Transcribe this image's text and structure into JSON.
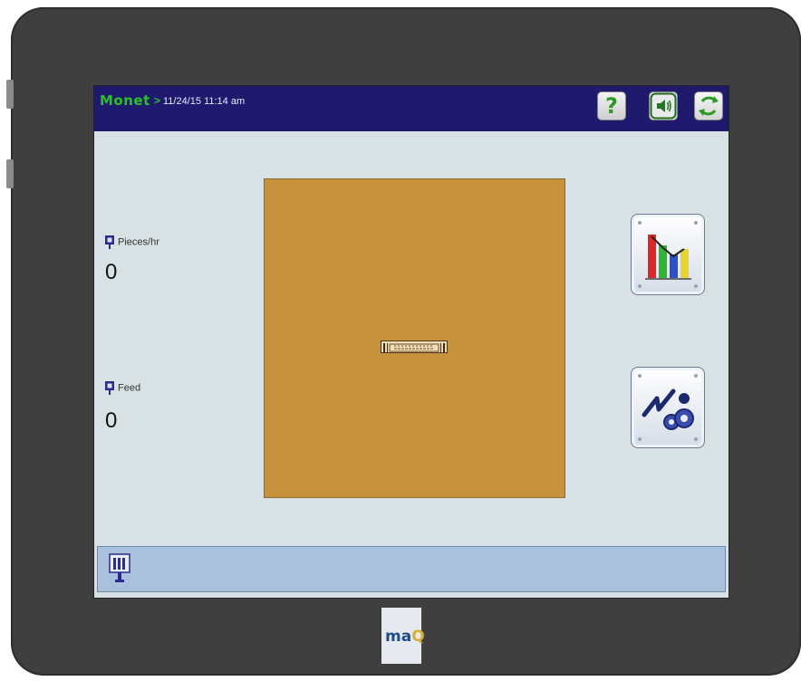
{
  "header": {
    "brand": "Monet",
    "separator": ">",
    "date": "11/24/15",
    "time": "11:14 am",
    "help_label": "?"
  },
  "metrics": {
    "pieces": {
      "label": "Pieces/hr",
      "value": "0"
    },
    "feed": {
      "label": "Feed",
      "value": "0"
    }
  },
  "panel": {
    "background_color": "#c8913e"
  },
  "icons": {
    "help": "help-icon",
    "sound": "speaker-icon",
    "refresh": "refresh-icon",
    "chart": "bar-chart-icon",
    "tools": "settings-gears-icon",
    "status": "device-status-icon"
  },
  "footer": {
    "logo_main": "ma",
    "logo_accent": "Q"
  },
  "colors": {
    "titlebar": "#201a6e",
    "brand": "#27c326",
    "screen": "#d8e1e3",
    "statusbar": "#a9c1dc"
  }
}
